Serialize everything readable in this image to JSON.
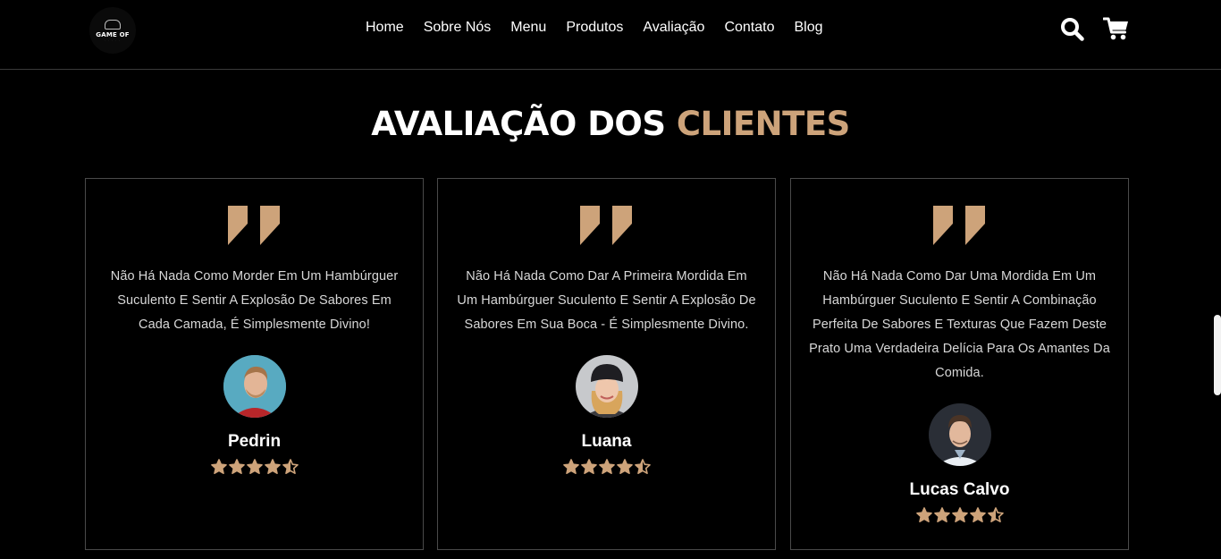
{
  "header": {
    "logo_text": "GAME OF",
    "nav": [
      "Home",
      "Sobre Nós",
      "Menu",
      "Produtos",
      "Avaliação",
      "Contato",
      "Blog"
    ],
    "icons": [
      "search-icon",
      "cart-icon"
    ]
  },
  "section": {
    "title_main": "AVALIAÇÃO DOS ",
    "title_accent": "CLIENTES"
  },
  "colors": {
    "accent": "#cda37a",
    "background": "#000000",
    "text": "#ffffff"
  },
  "testimonials": [
    {
      "text": "Não Há Nada Como Morder Em Um Hambúrguer Suculento E Sentir A Explosão De Sabores Em Cada Camada, É Simplesmente Divino!",
      "name": "Pedrin",
      "rating": 4.5
    },
    {
      "text": "Não Há Nada Como Dar A Primeira Mordida Em Um Hambúrguer Suculento E Sentir A Explosão De Sabores Em Sua Boca - É Simplesmente Divino.",
      "name": "Luana",
      "rating": 4.5
    },
    {
      "text": "Não Há Nada Como Dar Uma Mordida Em Um Hambúrguer Suculento E Sentir A Combinação Perfeita De Sabores E Texturas Que Fazem Deste Prato Uma Verdadeira Delícia Para Os Amantes Da Comida.",
      "name": "Lucas Calvo",
      "rating": 4.5
    }
  ]
}
